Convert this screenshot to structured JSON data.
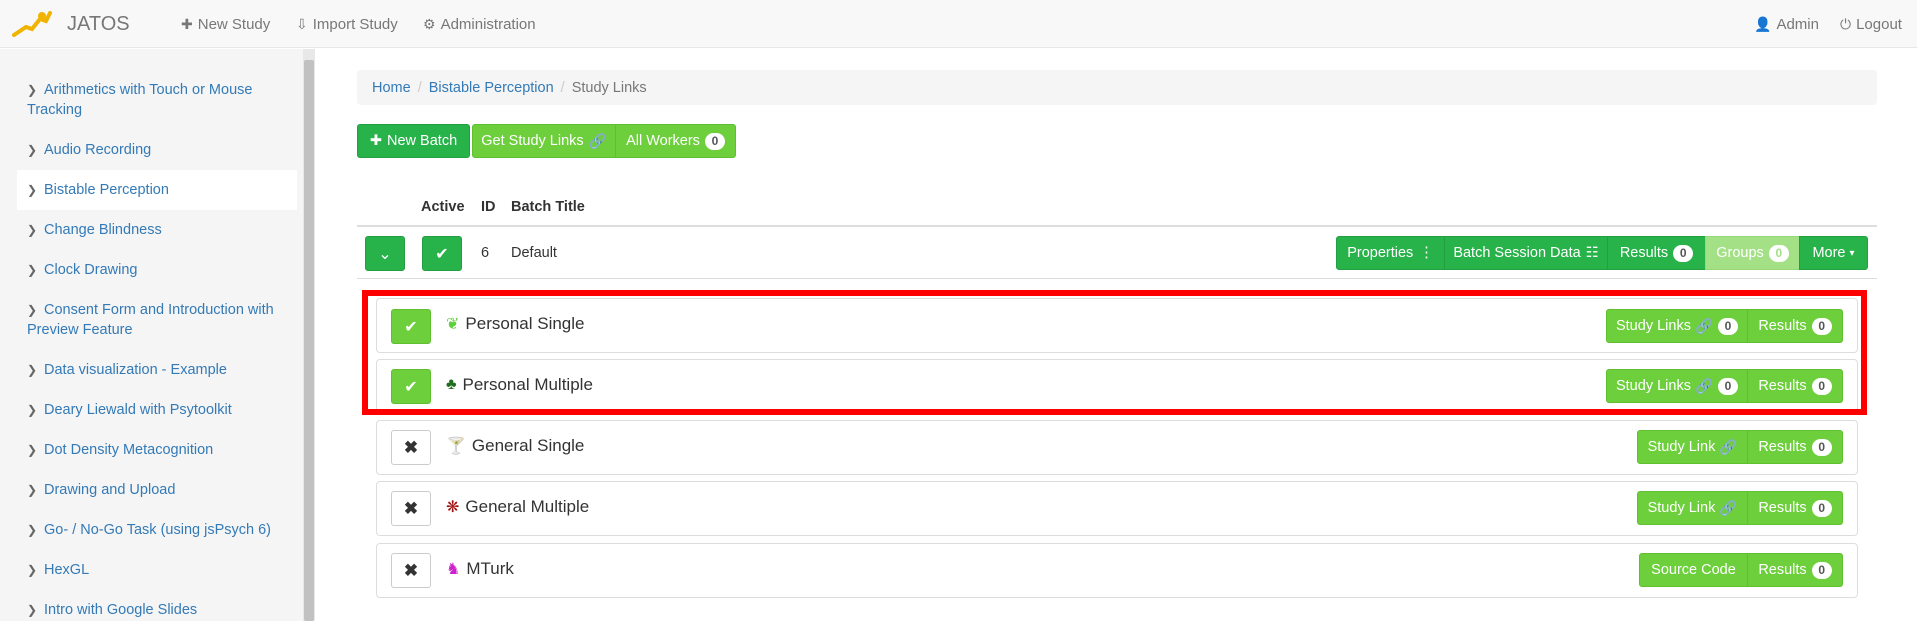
{
  "navbar": {
    "brand": "JATOS",
    "new_study": "New Study",
    "import_study": "Import Study",
    "administration": "Administration",
    "user": "Admin",
    "logout": "Logout"
  },
  "sidebar": {
    "items": [
      {
        "label": "Arithmetics with Touch or Mouse Tracking"
      },
      {
        "label": "Audio Recording"
      },
      {
        "label": "Bistable Perception"
      },
      {
        "label": "Change Blindness"
      },
      {
        "label": "Clock Drawing"
      },
      {
        "label": "Consent Form and Introduction with Preview Feature"
      },
      {
        "label": "Data visualization - Example"
      },
      {
        "label": "Deary Liewald with Psytoolkit"
      },
      {
        "label": "Dot Density Metacognition"
      },
      {
        "label": "Drawing and Upload"
      },
      {
        "label": "Go- / No-Go Task (using jsPsych 6)"
      },
      {
        "label": "HexGL"
      },
      {
        "label": "Intro with Google Slides"
      }
    ]
  },
  "breadcrumb": {
    "home": "Home",
    "study": "Bistable Perception",
    "current": "Study Links"
  },
  "toolbar": {
    "new_batch": "New Batch",
    "get_study_links": "Get Study Links",
    "all_workers": "All Workers",
    "all_workers_count": "0"
  },
  "table": {
    "headers": {
      "active": "Active",
      "id": "ID",
      "title": "Batch Title"
    },
    "batch": {
      "id": "6",
      "title": "Default",
      "properties": "Properties",
      "session_data": "Batch Session Data",
      "results": "Results",
      "results_count": "0",
      "groups": "Groups",
      "groups_count": "0",
      "more": "More"
    }
  },
  "link_types": [
    {
      "name": "Personal Single",
      "active": true,
      "button": "Study Links",
      "link_count": "0",
      "results": "Results",
      "results_count": "0",
      "icon": "leaf-icon",
      "icon_color": "#5fcf3b"
    },
    {
      "name": "Personal Multiple",
      "active": true,
      "button": "Study Links",
      "link_count": "0",
      "results": "Results",
      "results_count": "0",
      "icon": "tree-icon",
      "icon_color": "#1f6e1f"
    },
    {
      "name": "General Single",
      "active": false,
      "button": "Study Link",
      "results": "Results",
      "results_count": "0",
      "icon": "glass-icon",
      "icon_color": "#e0201f"
    },
    {
      "name": "General Multiple",
      "active": false,
      "button": "Study Link",
      "results": "Results",
      "results_count": "0",
      "icon": "asterisk-icon",
      "icon_color": "#a01010"
    },
    {
      "name": "MTurk",
      "active": false,
      "button": "Source Code",
      "results": "Results",
      "results_count": "0",
      "icon": "knight-icon",
      "icon_color": "#cc22cc"
    }
  ]
}
